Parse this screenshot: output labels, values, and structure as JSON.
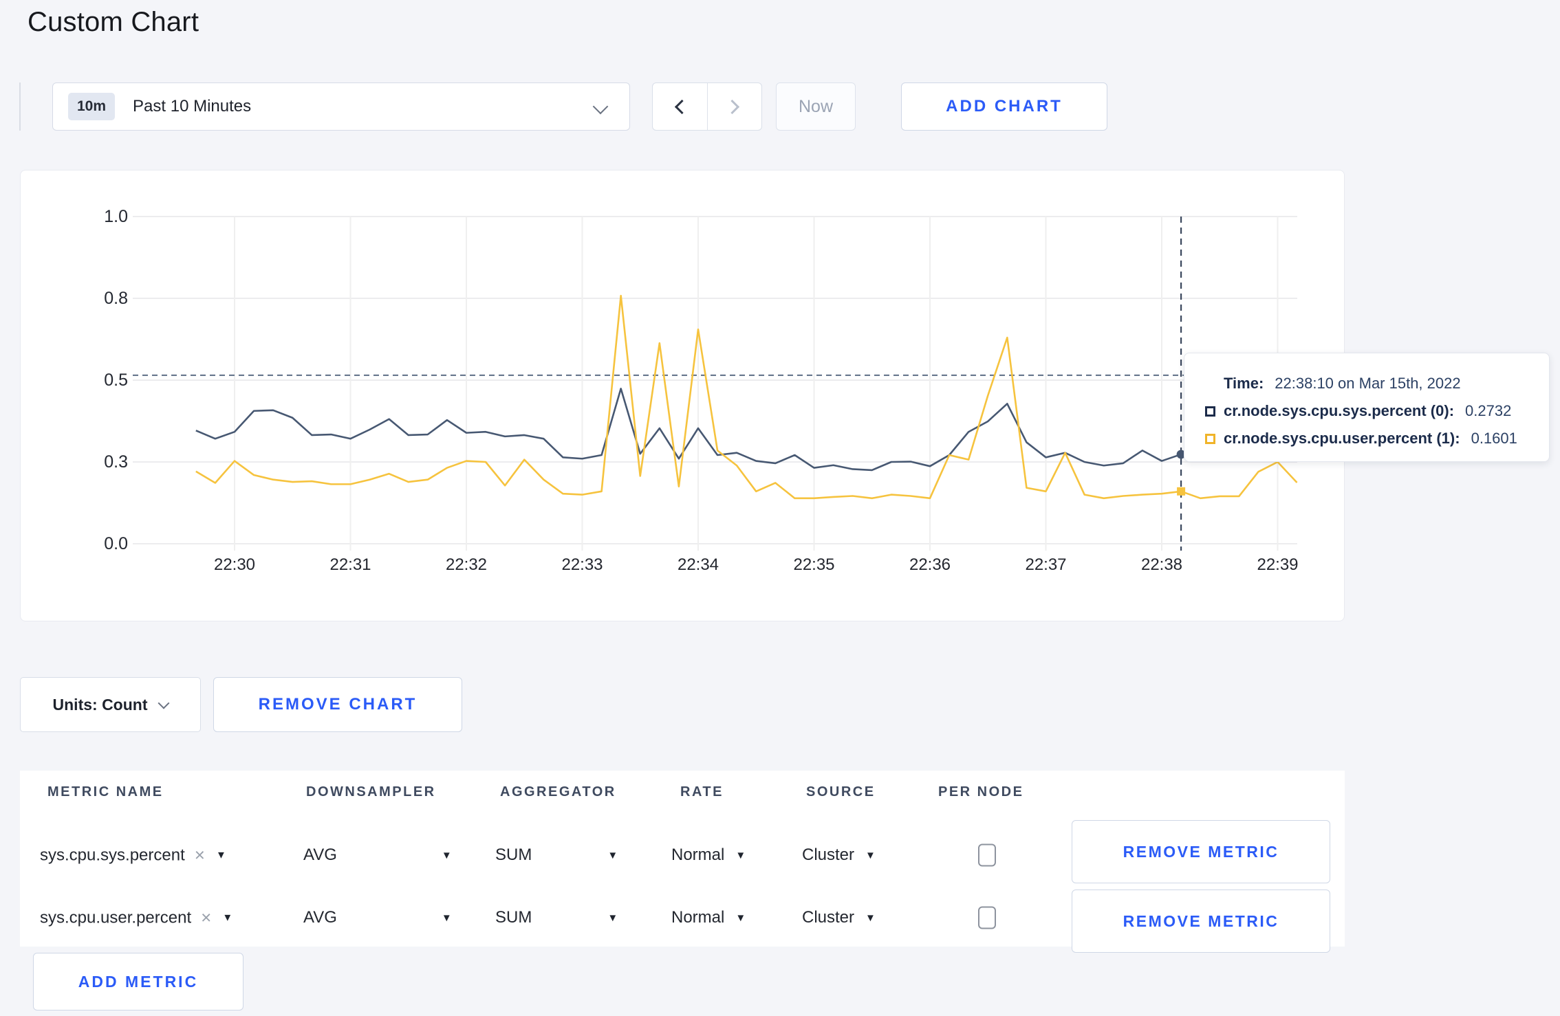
{
  "theme": {
    "accent": "#2b5bf7",
    "page_bg": "#f4f5f9"
  },
  "page": {
    "title": "Custom Chart"
  },
  "toolbar": {
    "time_window": {
      "badge": "10m",
      "label": "Past 10 Minutes"
    },
    "now_label": "Now",
    "add_chart_label": "ADD CHART"
  },
  "chart_controls": {
    "units_label": "Units: Count",
    "remove_chart_label": "REMOVE CHART"
  },
  "metrics_table": {
    "columns": [
      "METRIC NAME",
      "DOWNSAMPLER",
      "AGGREGATOR",
      "RATE",
      "SOURCE",
      "PER NODE"
    ],
    "remove_metric_label": "REMOVE METRIC",
    "add_metric_label": "ADD METRIC",
    "rows": [
      {
        "metric": "sys.cpu.sys.percent",
        "downsampler": "AVG",
        "aggregator": "SUM",
        "rate": "Normal",
        "source": "Cluster",
        "per_node_checked": false
      },
      {
        "metric": "sys.cpu.user.percent",
        "downsampler": "AVG",
        "aggregator": "SUM",
        "rate": "Normal",
        "source": "Cluster",
        "per_node_checked": false
      }
    ]
  },
  "chart_data": {
    "type": "line",
    "grid": true,
    "x_axis": {
      "first_point_offset_seconds": -20,
      "interval_seconds": 10,
      "tick_interval_seconds": 60,
      "tick_labels": [
        "22:30",
        "22:31",
        "22:32",
        "22:33",
        "22:34",
        "22:35",
        "22:36",
        "22:37",
        "22:38",
        "22:39"
      ]
    },
    "y_axis": {
      "min": 0,
      "max": 1,
      "ticks": [
        {
          "value": 0,
          "label": "0.0"
        },
        {
          "value": 0.25,
          "label": "0.3"
        },
        {
          "value": 0.5,
          "label": "0.5"
        },
        {
          "value": 0.75,
          "label": "0.8"
        },
        {
          "value": 1,
          "label": "1.0"
        }
      ]
    },
    "series": [
      {
        "name": "cr.node.sys.cpu.sys.percent (0)",
        "color": "#475872",
        "marker": "circle",
        "values": [
          0.346,
          0.321,
          0.342,
          0.406,
          0.408,
          0.385,
          0.332,
          0.334,
          0.321,
          0.349,
          0.381,
          0.332,
          0.334,
          0.378,
          0.339,
          0.342,
          0.328,
          0.332,
          0.321,
          0.264,
          0.26,
          0.271,
          0.474,
          0.275,
          0.353,
          0.26,
          0.353,
          0.271,
          0.278,
          0.253,
          0.246,
          0.271,
          0.232,
          0.24,
          0.228,
          0.225,
          0.25,
          0.251,
          0.237,
          0.271,
          0.342,
          0.374,
          0.428,
          0.31,
          0.264,
          0.278,
          0.25,
          0.239,
          0.246,
          0.285,
          0.253,
          0.2732,
          0.272,
          0.285,
          0.295,
          0.3,
          0.302,
          0.308
        ]
      },
      {
        "name": "cr.node.sys.cpu.user.percent (1)",
        "color": "#f6c33e",
        "marker": "square",
        "values": [
          0.221,
          0.186,
          0.253,
          0.21,
          0.196,
          0.189,
          0.191,
          0.182,
          0.182,
          0.196,
          0.214,
          0.189,
          0.196,
          0.232,
          0.253,
          0.25,
          0.178,
          0.257,
          0.196,
          0.153,
          0.15,
          0.16,
          0.758,
          0.207,
          0.613,
          0.175,
          0.655,
          0.285,
          0.239,
          0.16,
          0.186,
          0.139,
          0.139,
          0.143,
          0.146,
          0.139,
          0.15,
          0.146,
          0.139,
          0.271,
          0.257,
          0.453,
          0.63,
          0.171,
          0.16,
          0.278,
          0.15,
          0.139,
          0.146,
          0.15,
          0.153,
          0.1601,
          0.139,
          0.145,
          0.145,
          0.22,
          0.25,
          0.187
        ]
      }
    ],
    "tooltip": {
      "time_label": "Time:",
      "time_value": "22:38:10 on Mar 15th, 2022",
      "hover_index": 51,
      "crosshair_y_value": 0.515,
      "entries": [
        {
          "label": "cr.node.sys.cpu.sys.percent (0):",
          "value": "0.2732",
          "swatch_color": "#1c2b4a"
        },
        {
          "label": "cr.node.sys.cpu.user.percent (1):",
          "value": "0.1601",
          "swatch_color": "#f0b429"
        }
      ]
    }
  }
}
